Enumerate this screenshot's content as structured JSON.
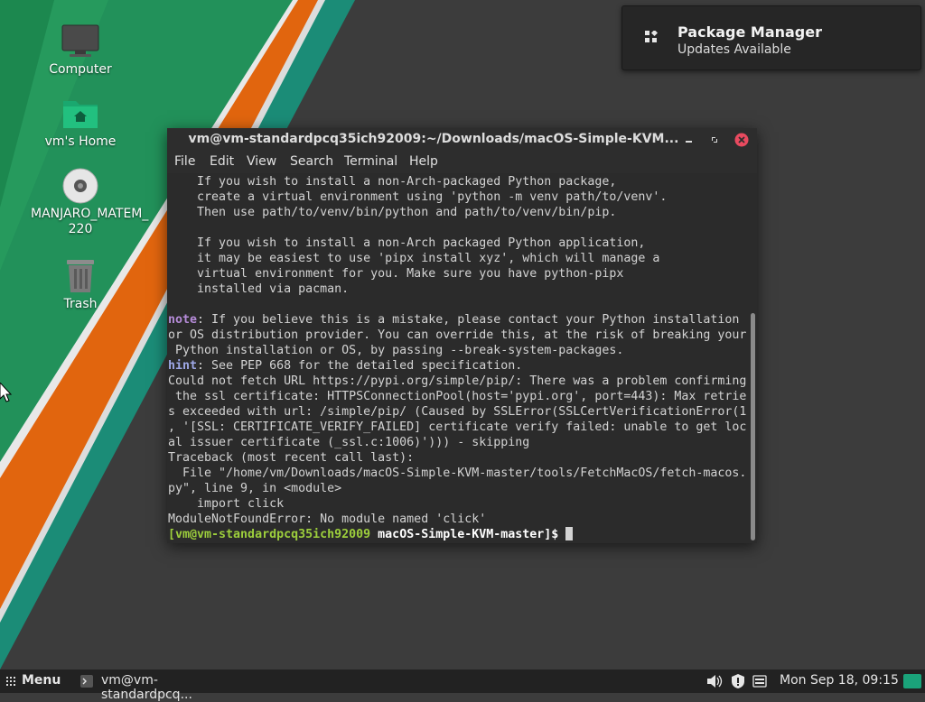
{
  "desktop": {
    "icons": [
      {
        "label": "Computer",
        "icon": "monitor-icon"
      },
      {
        "label": "vm's Home",
        "icon": "home-folder-icon"
      },
      {
        "label": "MANJARO_MATEM_\n220",
        "icon": "optical-disc-icon"
      },
      {
        "label": "Trash",
        "icon": "trash-icon"
      }
    ],
    "colors": {
      "background": "#3c3c3c",
      "green": "#1f8a55",
      "orange": "#e06a10",
      "teal": "#1a8a78"
    }
  },
  "notification": {
    "title": "Package Manager",
    "body": "Updates Available",
    "icon": "grid-apps-icon"
  },
  "terminal": {
    "title": "vm@vm-standardpcq35ich92009:~/Downloads/macOS-Simple-KVM...",
    "window_buttons": [
      "minimize-icon",
      "maximize-icon",
      "close-icon"
    ],
    "menu": [
      "File",
      "Edit",
      "View",
      "Search",
      "Terminal",
      "Help"
    ],
    "lines": [
      "    If you wish to install a non-Arch-packaged Python package,",
      "    create a virtual environment using 'python -m venv path/to/venv'.",
      "    Then use path/to/venv/bin/python and path/to/venv/bin/pip.",
      "",
      "    If you wish to install a non-Arch packaged Python application,",
      "    it may be easiest to use 'pipx install xyz', which will manage a",
      "    virtual environment for you. Make sure you have python-pipx",
      "    installed via pacman.",
      "",
      ": If you believe this is a mistake, please contact your Python installation",
      "or OS distribution provider. You can override this, at the risk of breaking your",
      " Python installation or OS, by passing --break-system-packages.",
      ": See PEP 668 for the detailed specification.",
      "Could not fetch URL https://pypi.org/simple/pip/: There was a problem confirming",
      " the ssl certificate: HTTPSConnectionPool(host='pypi.org', port=443): Max retrie",
      "s exceeded with url: /simple/pip/ (Caused by SSLError(SSLCertVerificationError(1",
      ", '[SSL: CERTIFICATE_VERIFY_FAILED] certificate verify failed: unable to get loc",
      "al issuer certificate (_ssl.c:1006)'))) - skipping",
      "Traceback (most recent call last):",
      "  File \"/home/vm/Downloads/macOS-Simple-KVM-master/tools/FetchMacOS/fetch-macos.",
      "py\", line 9, in <module>",
      "    import click",
      "ModuleNotFoundError: No module named 'click'"
    ],
    "note_keyword": "note",
    "hint_keyword": "hint",
    "prompt_user": "[vm@vm-standardpcq35ich92009",
    "prompt_dir": "macOS-Simple-KVM-master]$"
  },
  "taskbar": {
    "menu_label": "Menu",
    "task_label": "vm@vm-standardpcq...",
    "tray_icons": [
      "volume-icon",
      "security-shield-icon",
      "keyboard-icon"
    ],
    "clock": "Mon Sep 18, 09:15",
    "color": "#222222"
  }
}
